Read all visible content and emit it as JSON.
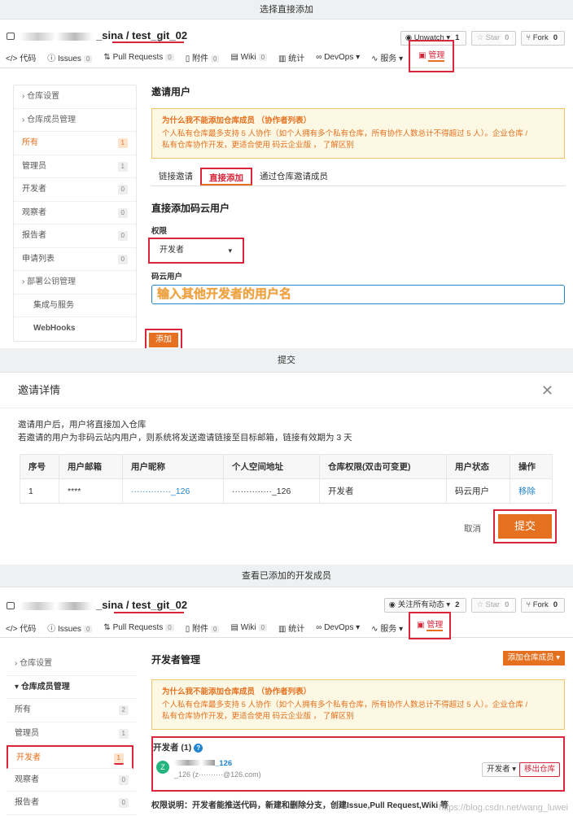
{
  "bands": {
    "step1": "选择直接添加",
    "step2": "提交",
    "step3": "查看已添加的开发成员"
  },
  "repo": {
    "owner_suffix": "_sina",
    "separator": "/",
    "name": "test_git_02"
  },
  "header_actions": {
    "unwatch_label": "Unwatch",
    "unwatch_count": "1",
    "watch_all_label": "关注所有动态",
    "watch_all_count": "2",
    "star_label": "Star",
    "star_count": "0",
    "fork_label": "Fork",
    "fork_count": "0"
  },
  "tabs": [
    {
      "label": "代码",
      "icon": "code-icon"
    },
    {
      "label": "Issues",
      "count": "0",
      "icon": "issue-icon"
    },
    {
      "label": "Pull Requests",
      "count": "0",
      "icon": "pull-request-icon"
    },
    {
      "label": "附件",
      "count": "0",
      "icon": "attachment-icon"
    },
    {
      "label": "Wiki",
      "count": "0",
      "icon": "wiki-icon"
    },
    {
      "label": "统计",
      "icon": "stats-icon"
    },
    {
      "label": "DevOps",
      "icon": "devops-icon"
    },
    {
      "label": "服务",
      "icon": "service-icon"
    },
    {
      "label": "管理",
      "icon": "manage-icon"
    }
  ],
  "sidebar": {
    "repo_settings": "仓库设置",
    "members_mgmt": "仓库成员管理",
    "all": "所有",
    "all_count": "1",
    "all_count2": "2",
    "admins": "管理员",
    "admins_count": "1",
    "developers": "开发者",
    "developers_count": "0",
    "developers_count2": "1",
    "observers": "观察者",
    "observers_count": "0",
    "reporters": "报告者",
    "reporters_count": "0",
    "applications": "申请列表",
    "applications_count": "0",
    "deploy_keys": "部署公钥管理",
    "integrations": "集成与服务",
    "webhooks": "WebHooks"
  },
  "invite": {
    "title": "邀请用户",
    "warn_title": "为什么我不能添加仓库成员 （协作者列表）",
    "warn_body_1": "个人私有仓库最多支持 5 人协作（如个人拥有多个私有仓库，所有协作人数总计不得超过 5 人）。企业仓库 /",
    "warn_body_2": "私有仓库协作开发，更适合使用 码云企业版 ， 了解区别",
    "tab_link": "链接邀请",
    "tab_direct": "直接添加",
    "tab_repo": "通过仓库邀请成员",
    "section_title": "直接添加码云用户",
    "perm_label": "权限",
    "perm_value": "开发者",
    "user_label": "码云用户",
    "user_value": "输入其他开发者的用户名",
    "add_button": "添加"
  },
  "dialog": {
    "title": "邀请详情",
    "line1": "邀请用户后，用户将直接加入仓库",
    "line2": "若邀请的用户为非码云站内用户，则系统将发送邀请链接至目标邮箱，链接有效期为 3 天",
    "columns": [
      "序号",
      "用户邮箱",
      "用户昵称",
      "个人空间地址",
      "仓库权限(双击可变更)",
      "用户状态",
      "操作"
    ],
    "row": [
      "1",
      "****",
      "··············_126",
      "··············_126",
      "开发者",
      "码云用户",
      "移除"
    ],
    "cancel": "取消",
    "submit": "提交"
  },
  "devs": {
    "title": "开发者管理",
    "add_member": "添加仓库成员",
    "heading": "开发者 (1)",
    "avatar_letter": "Z",
    "user_name": "_126",
    "user_sub": "_126 (z··········@126.com)",
    "role": "开发者",
    "remove": "移出仓库",
    "note": "权限说明：开发者能推送代码，新建和删除分支，创建Issue,Pull Request,Wiki 等"
  },
  "watermark": "https://blog.csdn.net/wang_luwei",
  "colors": {
    "accent": "#e5701f",
    "highlight": "#d9263a",
    "warn_bg": "#fcf8e3",
    "link": "#2185d0"
  }
}
